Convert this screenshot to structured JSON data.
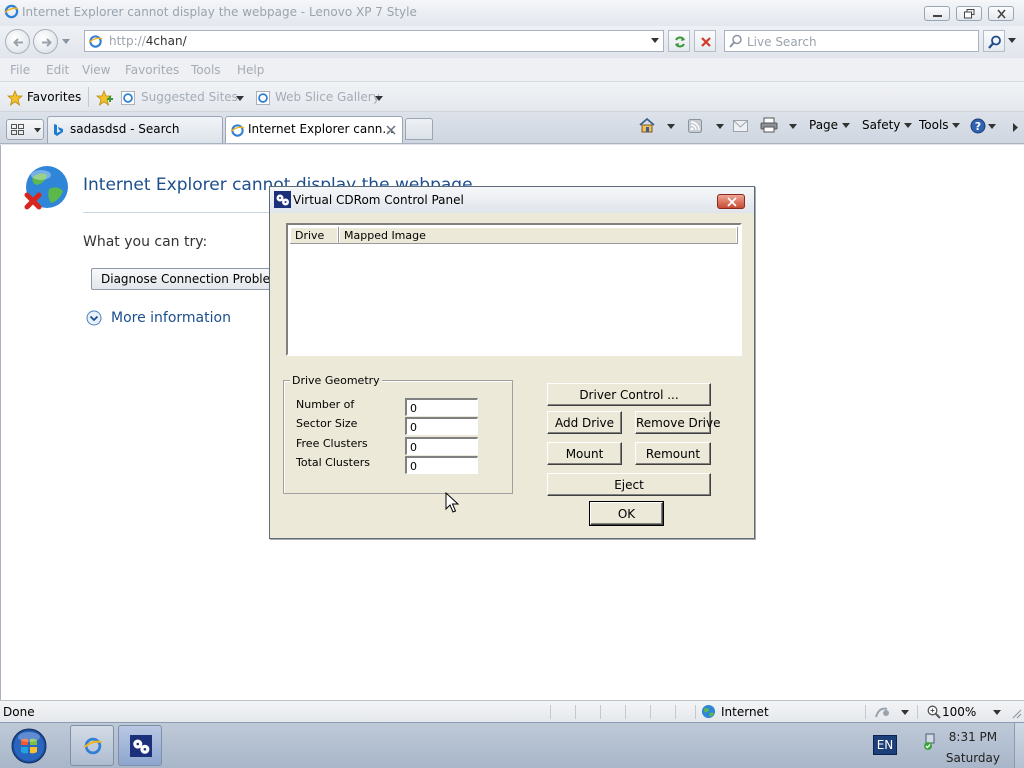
{
  "window": {
    "title": "Internet Explorer cannot display the webpage - Lenovo XP 7 Style"
  },
  "address_bar": {
    "protocol": "http://",
    "host": "4chan/"
  },
  "search_box": {
    "placeholder": "Live Search"
  },
  "menu": [
    "File",
    "Edit",
    "View",
    "Favorites",
    "Tools",
    "Help"
  ],
  "favorites_bar": {
    "favorites_label": "Favorites",
    "suggested_sites": "Suggested Sites",
    "web_slice_gallery": "Web Slice Gallery"
  },
  "tabs": [
    {
      "label": "sadasdsd - Search",
      "active": false
    },
    {
      "label": "Internet Explorer cann...",
      "active": true
    }
  ],
  "command_bar": {
    "page": "Page",
    "safety": "Safety",
    "tools": "Tools"
  },
  "page": {
    "error_title": "Internet Explorer cannot display the webpage",
    "what_you_can_try": "What you can try:",
    "diagnose_button": "Diagnose Connection Problems",
    "more_information": "More information"
  },
  "dialog": {
    "title": "Virtual CDRom Control Panel",
    "list_columns": [
      "Drive",
      "Mapped Image"
    ],
    "geometry": {
      "legend": "Drive Geometry",
      "rows": [
        {
          "label": "Number of",
          "value": "0"
        },
        {
          "label": "Sector Size",
          "value": "0"
        },
        {
          "label": "Free Clusters",
          "value": "0"
        },
        {
          "label": "Total Clusters",
          "value": "0"
        }
      ]
    },
    "buttons": {
      "driver_control": "Driver Control ...",
      "add_drive": "Add Drive",
      "remove_drive": "Remove Drive",
      "mount": "Mount",
      "remount": "Remount",
      "eject": "Eject",
      "ok": "OK"
    }
  },
  "status_bar": {
    "status": "Done",
    "zone": "Internet",
    "zoom": "100%"
  },
  "taskbar": {
    "language": "EN",
    "time": "8:31 PM",
    "day": "Saturday"
  },
  "colors": {
    "link_blue": "#1d4f8d",
    "dialog_face": "#ece9d8",
    "taskbar": "#a8b6c9"
  }
}
